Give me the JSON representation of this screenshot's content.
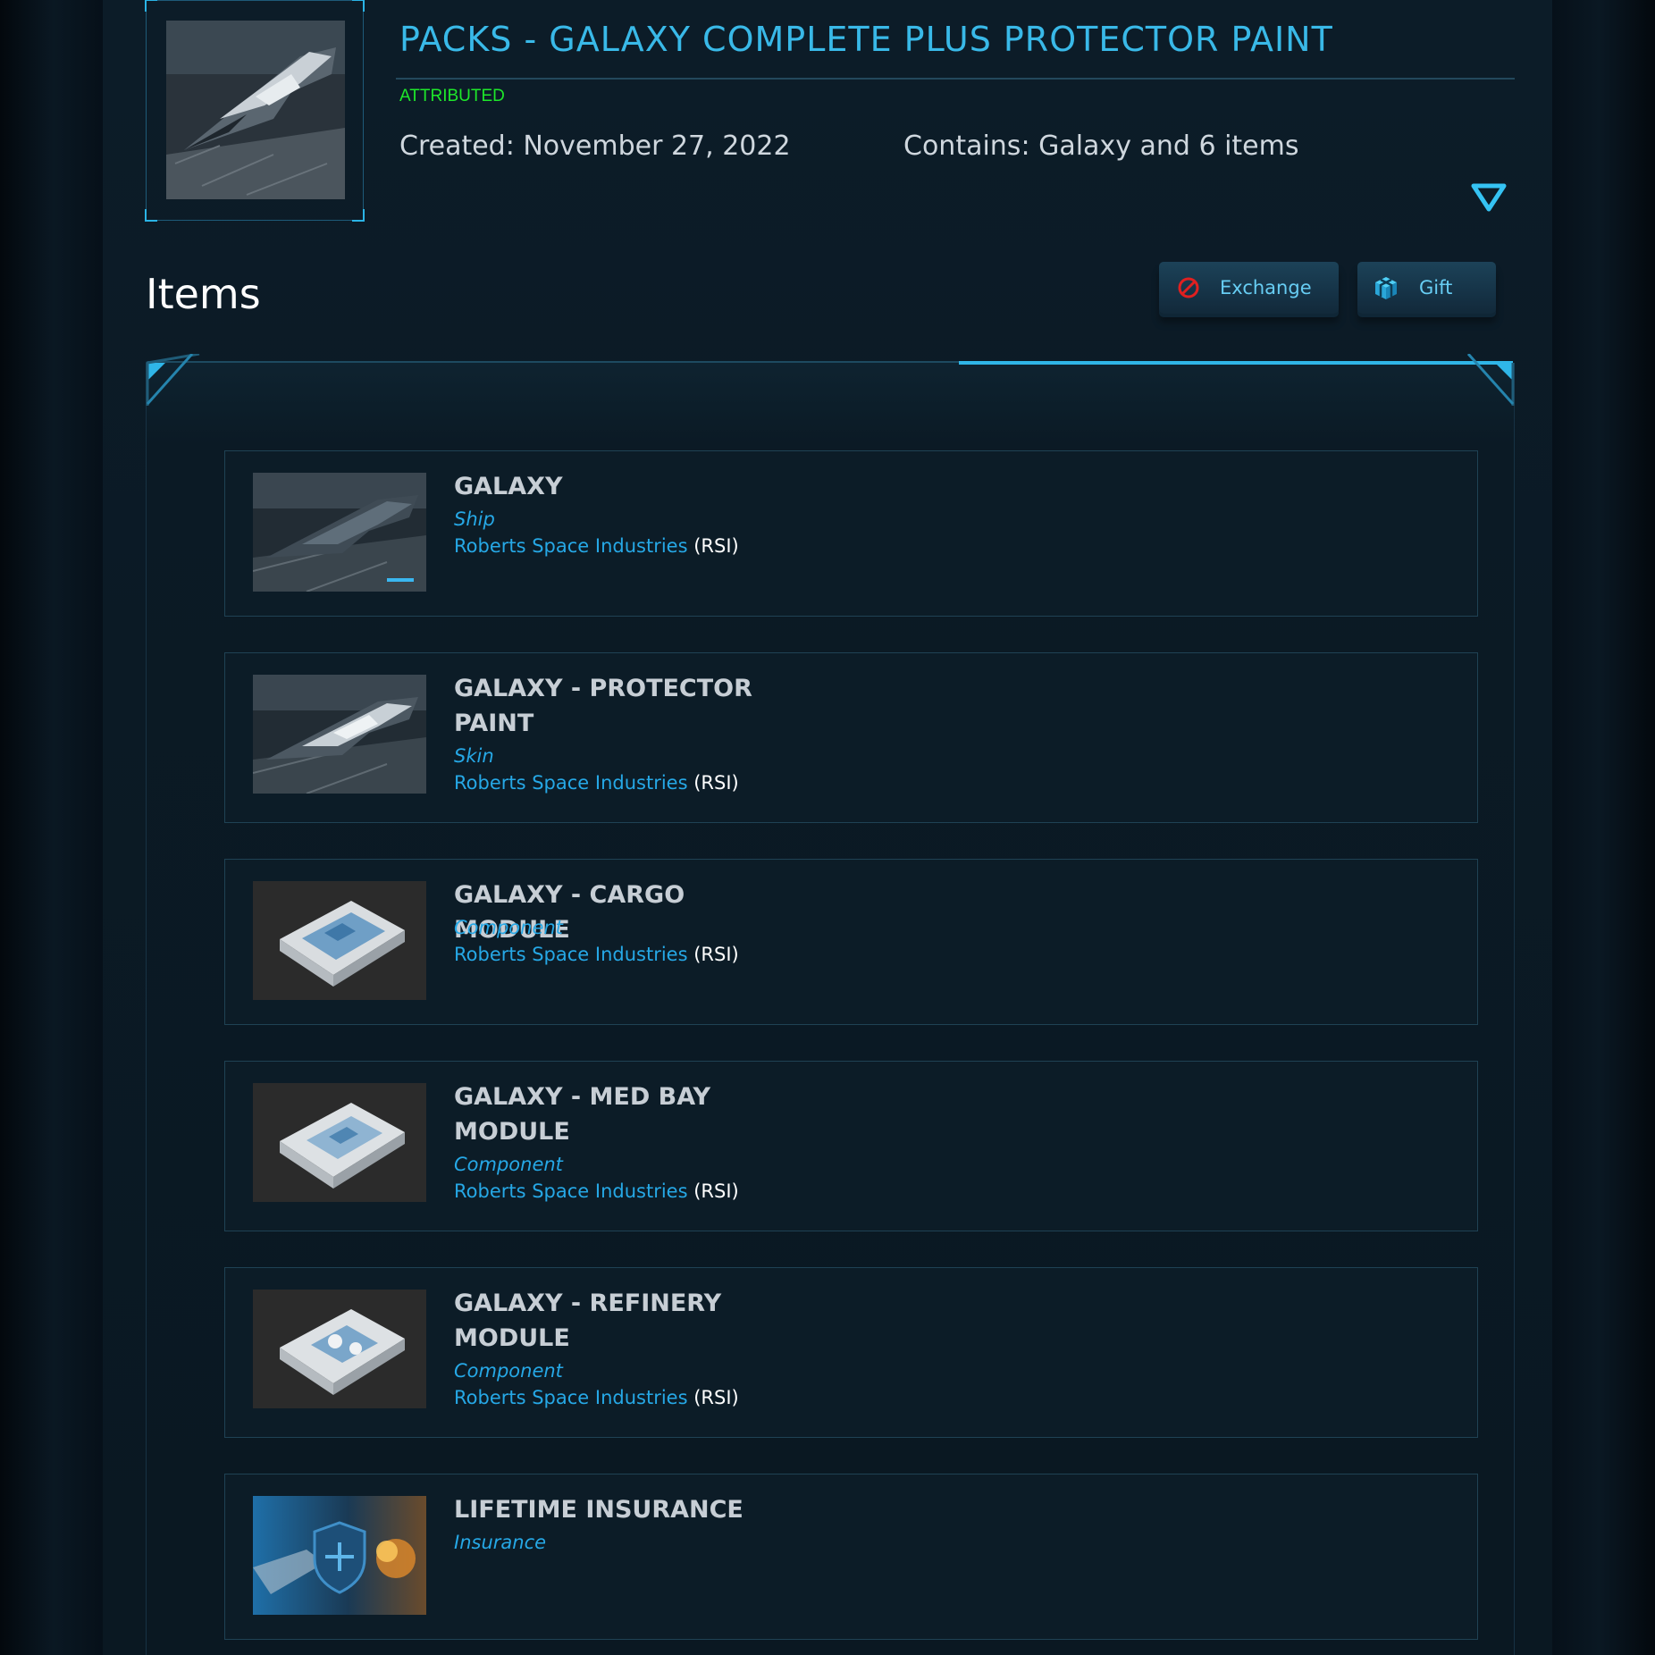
{
  "pack": {
    "title": "PACKS - GALAXY COMPLETE PLUS PROTECTOR PAINT",
    "status": "ATTRIBUTED",
    "created": "Created: November 27, 2022",
    "contains": "Contains: Galaxy and 6 items"
  },
  "items_section": {
    "heading": "Items",
    "exchange_label": "Exchange",
    "gift_label": "Gift"
  },
  "colors": {
    "accent": "#39b9e8",
    "attributed": "#1ee82a",
    "link": "#26a8e6",
    "exchange_icon": "#e02020"
  },
  "items": [
    {
      "name": "GALAXY",
      "type": "Ship",
      "manufacturer": "Roberts Space Industries",
      "code": "(RSI)",
      "image": "ship-image"
    },
    {
      "name": "GALAXY - PROTECTOR PAINT",
      "type": "Skin",
      "manufacturer": "Roberts Space Industries",
      "code": "(RSI)",
      "image": "ship-image"
    },
    {
      "name": "GALAXY - CARGO MODULE",
      "type": "Component",
      "manufacturer": "Roberts Space Industries",
      "code": "(RSI)",
      "image": "module-image"
    },
    {
      "name": "GALAXY - MED BAY MODULE",
      "type": "Component",
      "manufacturer": "Roberts Space Industries",
      "code": "(RSI)",
      "image": "module-image"
    },
    {
      "name": "GALAXY - REFINERY MODULE",
      "type": "Component",
      "manufacturer": "Roberts Space Industries",
      "code": "(RSI)",
      "image": "module-image"
    },
    {
      "name": "LIFETIME INSURANCE",
      "type": "Insurance",
      "manufacturer": "",
      "code": "",
      "image": "insurance-image"
    }
  ]
}
